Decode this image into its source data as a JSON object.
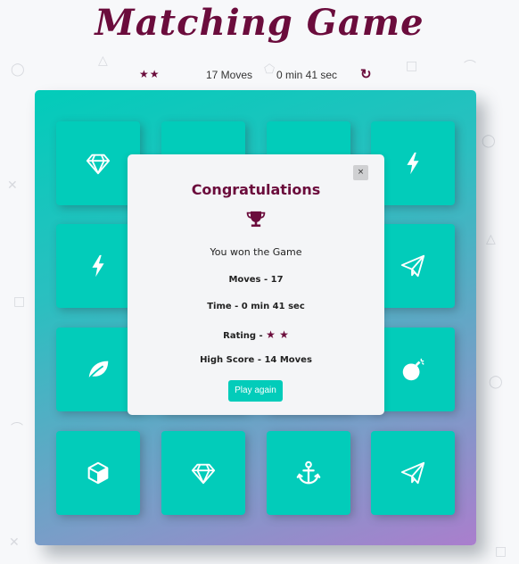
{
  "title": "Matching Game",
  "score_panel": {
    "stars": "★★",
    "moves": "17 Moves",
    "timer": "0 min 41 sec",
    "restart_icon": "restart-icon"
  },
  "colors": {
    "brand": "#6b0c3c",
    "card": "#02ccba",
    "deck_gradient": [
      "#02ccba",
      "#aa7ecd"
    ]
  },
  "cards": [
    {
      "icon": "diamond"
    },
    {
      "icon": "hidden"
    },
    {
      "icon": "hidden"
    },
    {
      "icon": "bolt"
    },
    {
      "icon": "bolt"
    },
    {
      "icon": "hidden"
    },
    {
      "icon": "hidden"
    },
    {
      "icon": "paper-plane"
    },
    {
      "icon": "leaf"
    },
    {
      "icon": "hidden"
    },
    {
      "icon": "hidden"
    },
    {
      "icon": "bomb"
    },
    {
      "icon": "cube"
    },
    {
      "icon": "diamond"
    },
    {
      "icon": "anchor"
    },
    {
      "icon": "paper-plane"
    }
  ],
  "modal": {
    "close_label": "×",
    "title": "Congratulations",
    "trophy_icon": "trophy-icon",
    "message": "You won the Game",
    "moves_label": "Moves - 17",
    "time_label": "Time - 0 min 41 sec",
    "rating_label": "Rating - ",
    "rating_stars": "★ ★",
    "high_score_label": "High Score - 14 Moves",
    "play_again_label": "Play again"
  }
}
